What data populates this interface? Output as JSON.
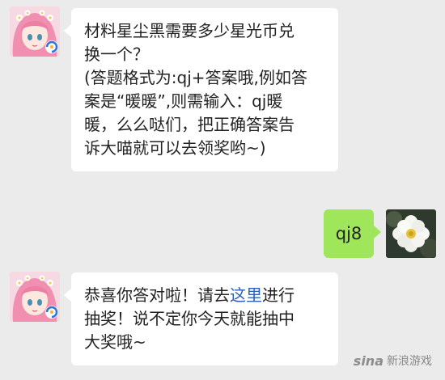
{
  "messages": [
    {
      "sender": "bot",
      "lines": [
        "材料星尘黑需要多少星光币兑",
        "换一个？",
        "(答题格式为:qj+答案哦,例如答",
        "案是“暖暖”,则需输入：qj暖",
        "暖，么么哒们，把正确答案告",
        "诉大喵就可以去领奖哟~)"
      ]
    },
    {
      "sender": "user",
      "text": "qj8"
    },
    {
      "sender": "bot",
      "line1_before": "恭喜你答对啦！请去",
      "line1_link": "这里",
      "line1_after": "进行",
      "line2": "抽奖！说不定你今天就能抽中",
      "line3": "大奖哦~"
    }
  ],
  "watermark": {
    "logo": "sina",
    "text": "新浪游戏"
  },
  "colors": {
    "background": "#ebebeb",
    "bubble_bot": "#ffffff",
    "bubble_user": "#9fe65a",
    "link": "#2c60b8"
  }
}
